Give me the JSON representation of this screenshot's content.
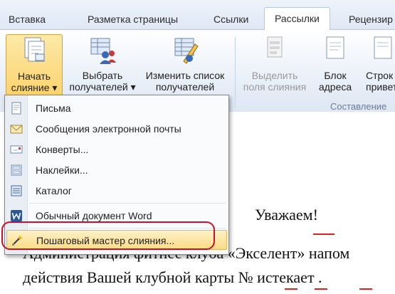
{
  "tabs": [
    {
      "label": "Вставка"
    },
    {
      "label": "Разметка страницы"
    },
    {
      "label": "Ссылки"
    },
    {
      "label": "Рассылки",
      "active": true
    },
    {
      "label": "Рецензир"
    }
  ],
  "ribbon": {
    "start_merge": {
      "line1": "Начать",
      "line2": "слияние ▾"
    },
    "select_recipients": {
      "line1": "Выбрать",
      "line2": "получателей ▾"
    },
    "edit_list": {
      "line1": "Изменить список",
      "line2": "получателей"
    },
    "highlight_fields": {
      "line1": "Выделить",
      "line2": "поля слияния"
    },
    "address_block": {
      "line1": "Блок",
      "line2": "адреса"
    },
    "greeting_line": {
      "line1": "Строк",
      "line2": "привето"
    },
    "group_caption": "Составление"
  },
  "menu": {
    "items": [
      {
        "label": "Письма",
        "icon": "letter-icon"
      },
      {
        "label": "Сообщения электронной почты",
        "icon": "email-icon"
      },
      {
        "label": "Конверты...",
        "icon": "envelope-icon"
      },
      {
        "label": "Наклейки...",
        "icon": "labels-icon"
      },
      {
        "label": "Каталог",
        "icon": "directory-icon"
      },
      {
        "label": "Обычный документ Word",
        "icon": "word-icon"
      },
      {
        "label": "Пошаговый мастер слияния...",
        "icon": "wizard-icon",
        "highlighted": true
      }
    ]
  },
  "document": {
    "line1": "Уважаем!",
    "line2": "Администрация фитнес клуба «Экселент» напом",
    "line3": "действия Вашей клубной карты №  истекает ."
  },
  "colors": {
    "highlight": "#fbdc85",
    "annotation": "#c8102e",
    "active_tab": "#ffffff"
  }
}
